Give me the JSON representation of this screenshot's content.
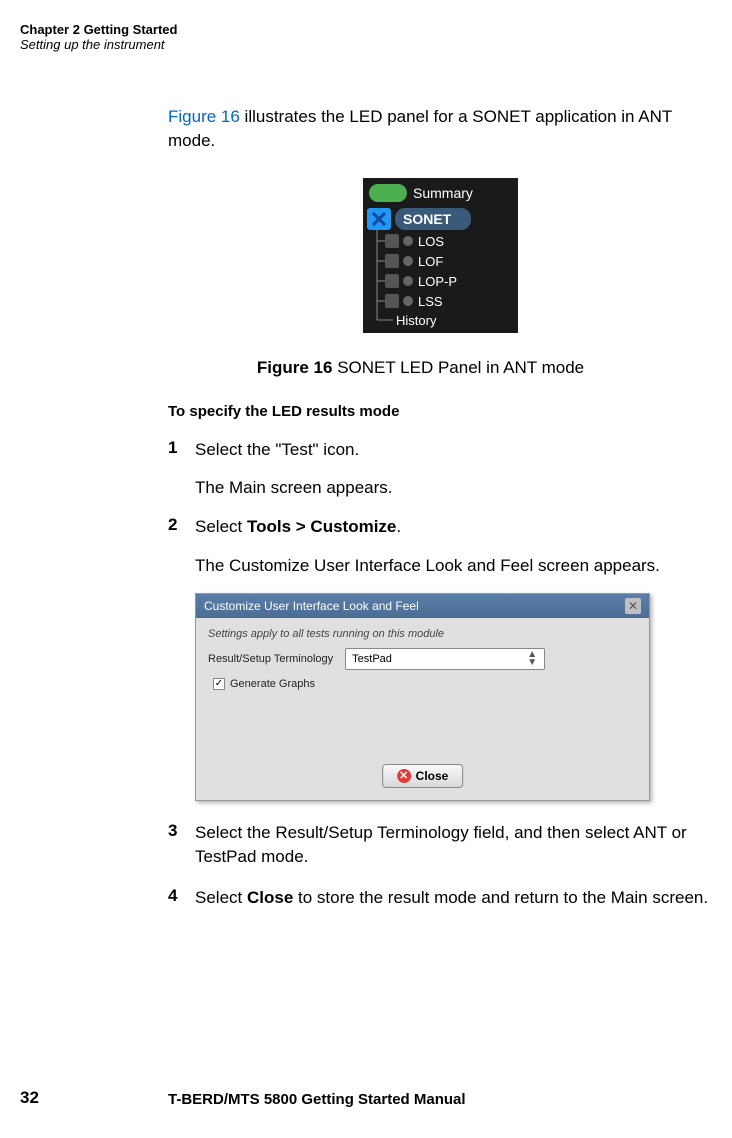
{
  "header": {
    "chapter": "Chapter 2  Getting Started",
    "section": "Setting up the instrument"
  },
  "intro": {
    "link": "Figure 16",
    "text": " illustrates the LED panel for a SONET application in ANT mode."
  },
  "led_panel": {
    "summary": "Summary",
    "sonet": "SONET",
    "items": [
      "LOS",
      "LOF",
      "LOP-P",
      "LSS",
      "History"
    ]
  },
  "figure": {
    "num": "Figure 16",
    "caption": "  SONET LED Panel in ANT mode"
  },
  "subheading": "To specify the LED results mode",
  "steps": {
    "s1": {
      "num": "1",
      "text": "Select the \"Test\" icon.",
      "follow": "The Main screen appears."
    },
    "s2": {
      "num": "2",
      "text_pre": "Select ",
      "text_bold": "Tools > Customize",
      "text_post": ".",
      "follow": "The Customize User Interface Look and Feel screen appears."
    },
    "s3": {
      "num": "3",
      "text": "Select the Result/Setup Terminology field, and then select ANT or TestPad mode."
    },
    "s4": {
      "num": "4",
      "text_pre": "Select ",
      "text_bold": "Close",
      "text_post": " to store the result mode and return to the Main screen."
    }
  },
  "dialog": {
    "title": "Customize User Interface Look and Feel",
    "note": "Settings apply to all tests running on this module",
    "label": "Result/Setup Terminology",
    "dropdown_value": "TestPad",
    "checkbox_label": "Generate Graphs",
    "close_btn": "Close"
  },
  "footer": {
    "page": "32",
    "text": "T-BERD/MTS 5800 Getting Started Manual"
  }
}
